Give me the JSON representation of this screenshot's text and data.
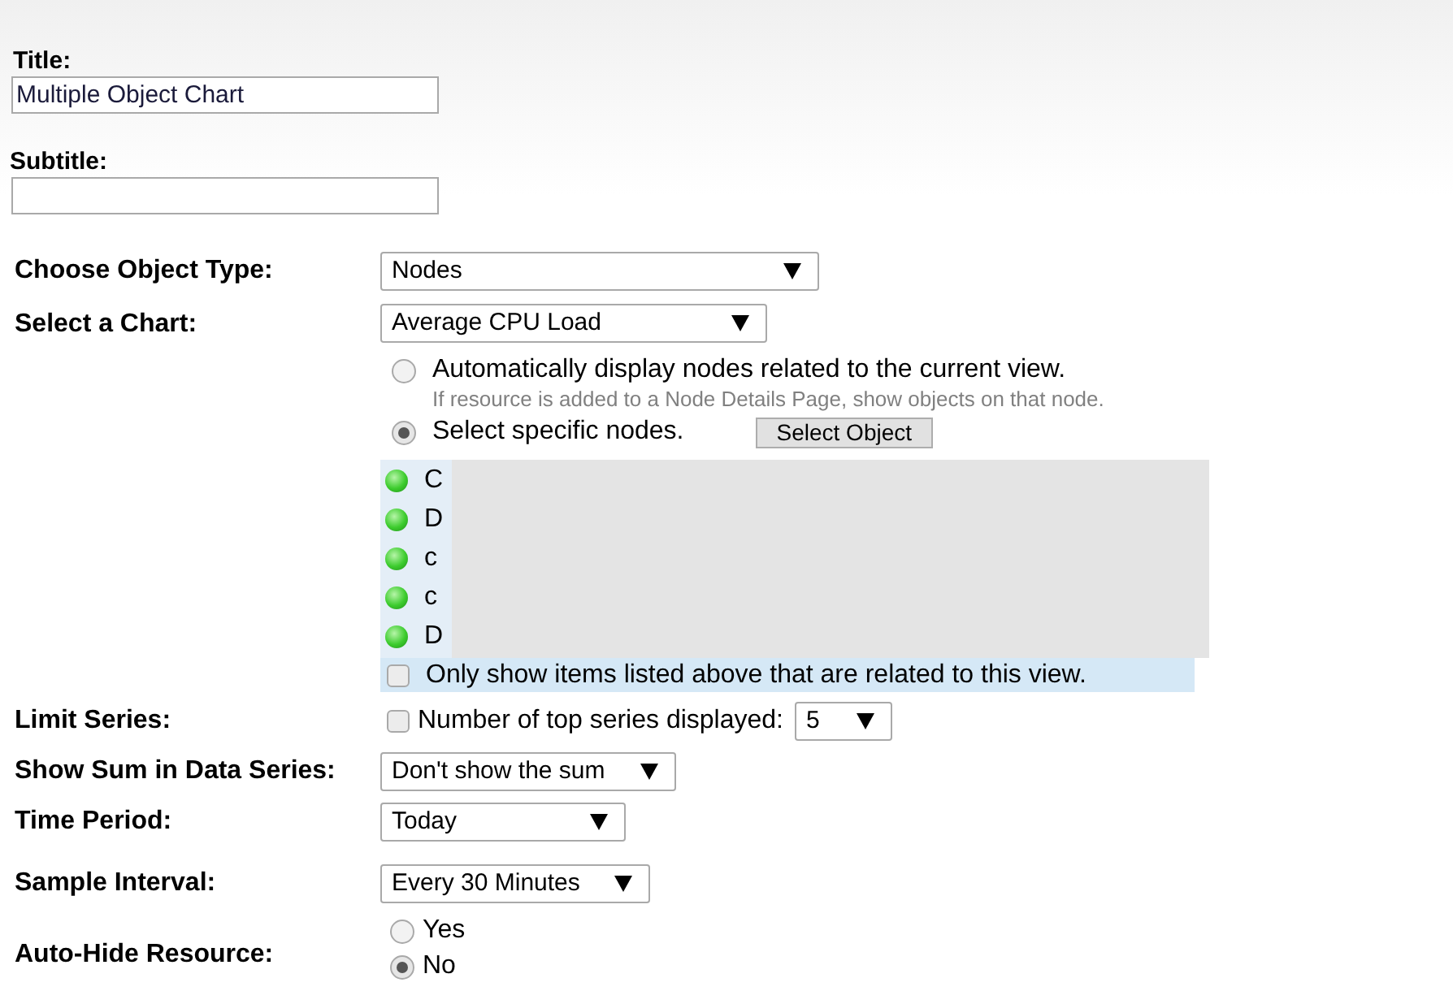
{
  "title_field": {
    "label": "Title:",
    "value": "Multiple Object Chart"
  },
  "subtitle_field": {
    "label": "Subtitle:"
  },
  "object_type": {
    "label": "Choose Object Type:",
    "value": "Nodes"
  },
  "chart": {
    "label": "Select a Chart:",
    "value": "Average CPU Load"
  },
  "node_selection": {
    "options": [
      {
        "label": "Automatically display nodes related to the current view.",
        "hint": "If resource is added to a Node Details Page, show objects on that node.",
        "selected": false
      },
      {
        "label": "Select specific nodes.",
        "selected": true
      }
    ],
    "select_button": "Select Object",
    "nodes": [
      {
        "name": "C",
        "color": "#3dcc2e"
      },
      {
        "name": "D",
        "color": "#3dcc2e"
      },
      {
        "name": "c",
        "color": "#3dcc2e"
      },
      {
        "name": "c",
        "color": "#3dcc2e"
      },
      {
        "name": "D",
        "color": "#3dcc2e"
      }
    ],
    "related_only": {
      "label": "Only show items listed above that are related to this view.",
      "checked": false
    }
  },
  "limit_series": {
    "label": "Limit Series:",
    "checkbox_label": "Number of top series displayed:",
    "checked": false,
    "value": "5"
  },
  "show_sum": {
    "label": "Show Sum in Data Series:",
    "value": "Don't show the sum"
  },
  "time_period": {
    "label": "Time Period:",
    "value": "Today"
  },
  "sample_interval": {
    "label": "Sample Interval:",
    "value": "Every 30 Minutes"
  },
  "auto_hide": {
    "label": "Auto-Hide Resource:",
    "options": [
      {
        "label": "Yes",
        "selected": false
      },
      {
        "label": "No",
        "selected": true
      }
    ]
  }
}
